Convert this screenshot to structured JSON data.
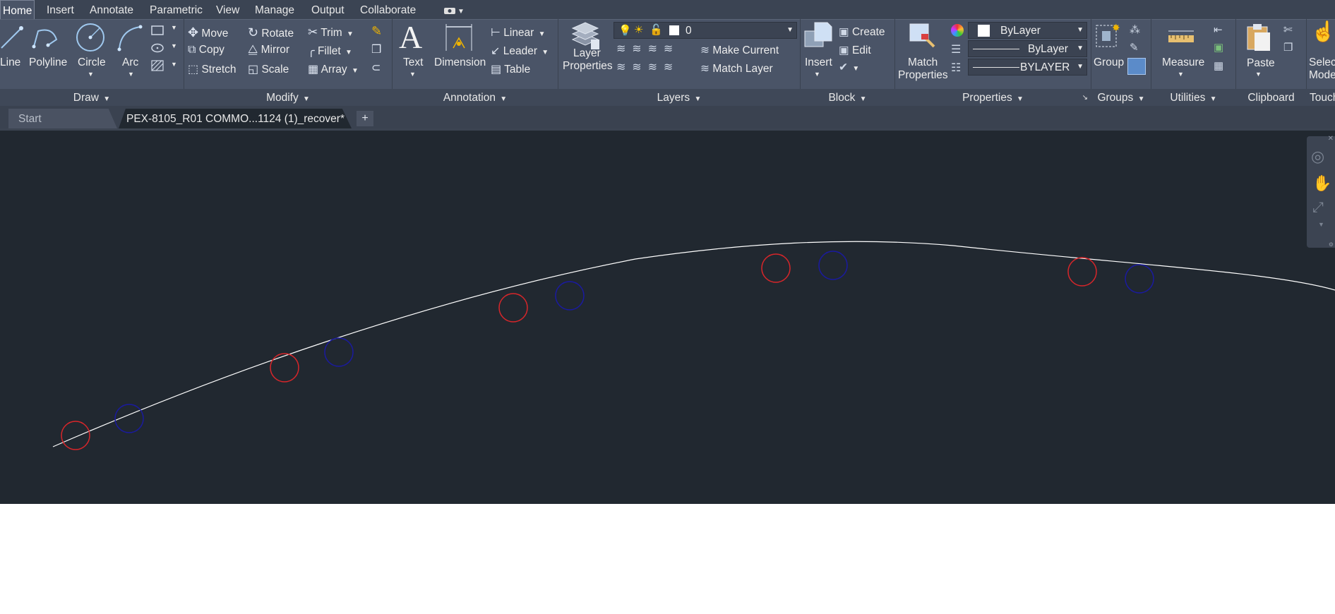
{
  "ribbon_tabs": [
    "Home",
    "Insert",
    "Annotate",
    "Parametric",
    "View",
    "Manage",
    "Output",
    "Collaborate"
  ],
  "active_tab": "Home",
  "draw": {
    "line": "Line",
    "polyline": "Polyline",
    "circle": "Circle",
    "arc": "Arc",
    "title": "Draw"
  },
  "modify": {
    "move": "Move",
    "rotate": "Rotate",
    "trim": "Trim",
    "copy": "Copy",
    "mirror": "Mirror",
    "fillet": "Fillet",
    "stretch": "Stretch",
    "scale": "Scale",
    "array": "Array",
    "title": "Modify"
  },
  "annotation": {
    "text": "Text",
    "dimension": "Dimension",
    "linear": "Linear",
    "leader": "Leader",
    "table": "Table",
    "title": "Annotation"
  },
  "layers": {
    "layer_properties_1": "Layer",
    "layer_properties_2": "Properties",
    "current_layer": "0",
    "make_current": "Make Current",
    "match_layer": "Match Layer",
    "title": "Layers"
  },
  "block": {
    "insert": "Insert",
    "create": "Create",
    "edit": "Edit",
    "title": "Block"
  },
  "properties": {
    "match_1": "Match",
    "match_2": "Properties",
    "color": "ByLayer",
    "linetype": "ByLayer",
    "lineweight": "BYLAYER",
    "title": "Properties"
  },
  "groups": {
    "group": "Group",
    "title": "Groups"
  },
  "utilities": {
    "measure": "Measure",
    "title": "Utilities"
  },
  "clipboard": {
    "paste": "Paste",
    "title": "Clipboard"
  },
  "select": {
    "label_1": "Selec",
    "label_2": "Mode",
    "title": "Touch"
  },
  "doc_tabs": {
    "start": "Start",
    "drawing": "PEX-8105_R01 COMMO...1124 (1)_recover*"
  },
  "colors": {
    "red_circle": "#d8262a",
    "blue_circle": "#1a1aa0",
    "polyline": "#ffffff",
    "canvas": "#212830"
  }
}
